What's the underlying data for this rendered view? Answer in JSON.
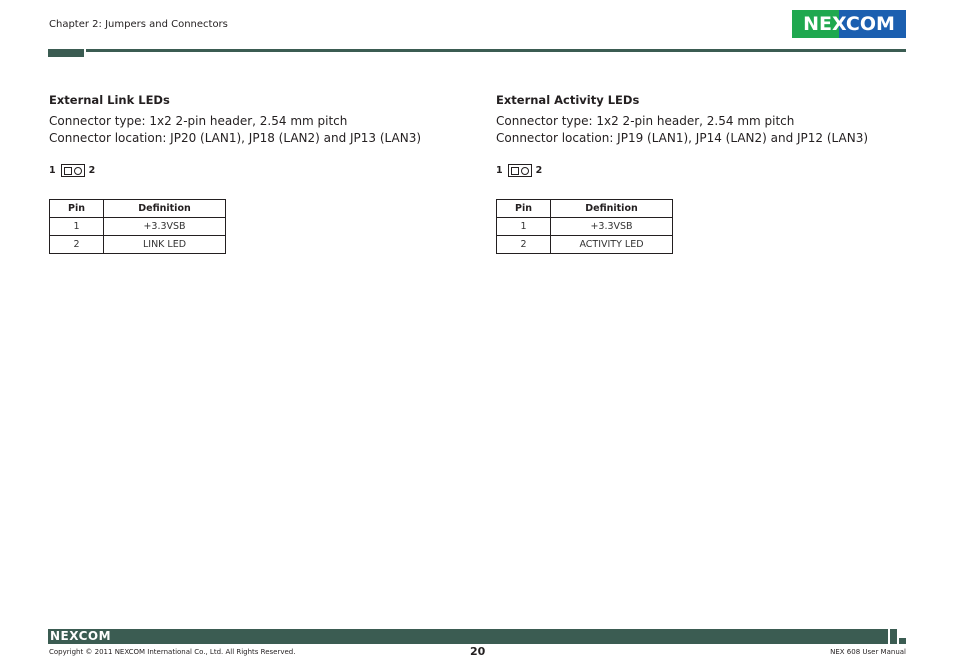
{
  "header": {
    "chapter": "Chapter 2: Jumpers and Connectors",
    "logo_text": "NEXCOM",
    "brand_colors": {
      "green": "#1fa84f",
      "blue": "#1b5fb0",
      "red": "#e2231a",
      "bar": "#3b5c52"
    }
  },
  "sections": [
    {
      "title": "External Link LEDs",
      "connector_type": "Connector type: 1x2 2-pin header, 2.54 mm pitch",
      "connector_location": "Connector location: JP20 (LAN1), JP18 (LAN2) and JP13 (LAN3)",
      "pin_label_left": "1",
      "pin_label_right": "2",
      "table": {
        "headers": [
          "Pin",
          "Definition"
        ],
        "rows": [
          [
            "1",
            "+3.3VSB"
          ],
          [
            "2",
            "LINK LED"
          ]
        ]
      }
    },
    {
      "title": "External Activity LEDs",
      "connector_type": "Connector type: 1x2 2-pin header, 2.54 mm pitch",
      "connector_location": "Connector location: JP19 (LAN1), JP14 (LAN2) and JP12 (LAN3)",
      "pin_label_left": "1",
      "pin_label_right": "2",
      "table": {
        "headers": [
          "Pin",
          "Definition"
        ],
        "rows": [
          [
            "1",
            "+3.3VSB"
          ],
          [
            "2",
            "ACTIVITY LED"
          ]
        ]
      }
    }
  ],
  "footer": {
    "logo_text": "NEXCOM",
    "copyright": "Copyright © 2011 NEXCOM International Co., Ltd. All Rights Reserved.",
    "page_number": "20",
    "manual_name": "NEX 608 User Manual"
  }
}
